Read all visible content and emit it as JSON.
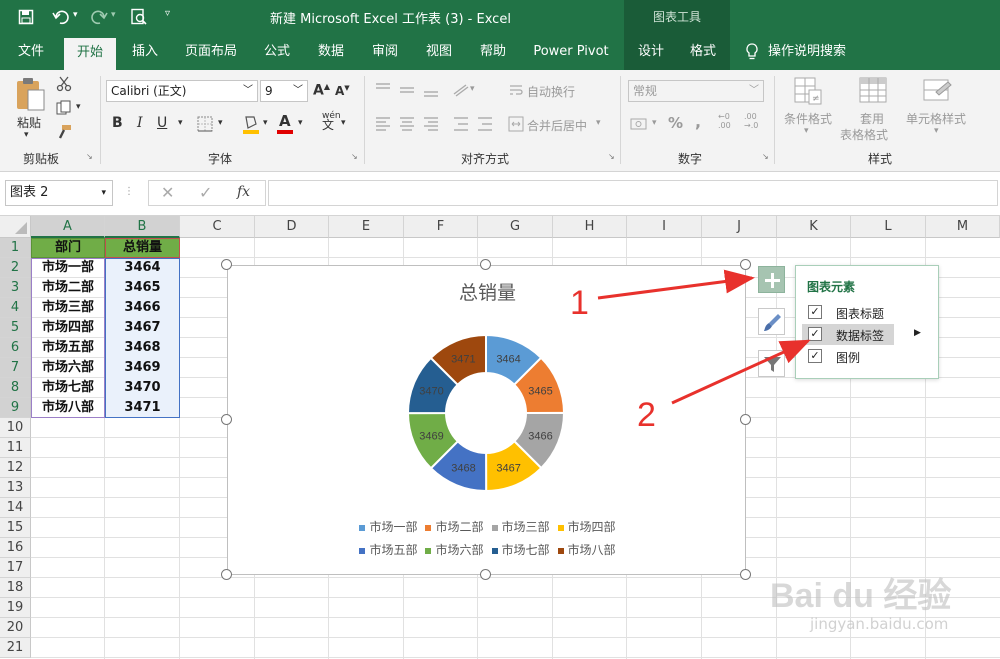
{
  "titlebar": {
    "title": "新建 Microsoft Excel 工作表 (3)  -  Excel",
    "contextual": "图表工具"
  },
  "tabs": [
    "文件",
    "开始",
    "插入",
    "页面布局",
    "公式",
    "数据",
    "审阅",
    "视图",
    "帮助",
    "Power Pivot",
    "设计",
    "格式"
  ],
  "tell_me": "操作说明搜索",
  "ribbon": {
    "paste_label": "粘贴",
    "font_name": "Calibri (正文)",
    "font_size": "9",
    "wrap_text": "自动换行",
    "merge_center": "合并后居中",
    "number_format": "常规",
    "conditional_format": "条件格式",
    "format_table_1": "套用",
    "format_table_2": "表格格式",
    "cell_styles": "单元格样式",
    "groups": {
      "clipboard": "剪贴板",
      "font": "字体",
      "alignment": "对齐方式",
      "number": "数字",
      "styles": "样式"
    }
  },
  "formula_bar": {
    "name_box": "图表 2",
    "fx": "fx",
    "formula": ""
  },
  "columns": [
    "A",
    "B",
    "C",
    "D",
    "E",
    "F",
    "G",
    "H",
    "I",
    "J",
    "K",
    "L",
    "M"
  ],
  "rows": [
    "1",
    "2",
    "3",
    "4",
    "5",
    "6",
    "7",
    "8",
    "9",
    "10",
    "11",
    "12",
    "13",
    "14",
    "15",
    "16",
    "17",
    "18",
    "19",
    "20",
    "21"
  ],
  "table": {
    "headers": [
      "部门",
      "总销量"
    ],
    "rows": [
      [
        "市场一部",
        "3464"
      ],
      [
        "市场二部",
        "3465"
      ],
      [
        "市场三部",
        "3466"
      ],
      [
        "市场四部",
        "3467"
      ],
      [
        "市场五部",
        "3468"
      ],
      [
        "市场六部",
        "3469"
      ],
      [
        "市场七部",
        "3470"
      ],
      [
        "市场八部",
        "3471"
      ]
    ],
    "header_color": "#70ad47"
  },
  "chart_data": {
    "type": "pie",
    "variant": "doughnut",
    "title": "总销量",
    "categories": [
      "市场一部",
      "市场二部",
      "市场三部",
      "市场四部",
      "市场五部",
      "市场六部",
      "市场七部",
      "市场八部"
    ],
    "values": [
      3464,
      3465,
      3466,
      3467,
      3468,
      3469,
      3470,
      3471
    ],
    "colors": [
      "#5b9bd5",
      "#ed7d31",
      "#a5a5a5",
      "#ffc000",
      "#4472c4",
      "#70ad47",
      "#255e91",
      "#9e480e"
    ],
    "data_labels": true,
    "legend": "bottom"
  },
  "chart_elements_panel": {
    "title": "图表元素",
    "items": [
      {
        "label": "图表标题",
        "checked": true
      },
      {
        "label": "数据标签",
        "checked": true
      },
      {
        "label": "图例",
        "checked": true
      }
    ]
  },
  "annotations": {
    "one": "1",
    "two": "2",
    "arrow_color": "#e8312c"
  },
  "watermark": {
    "brand": "Bai du 经验",
    "url": "jingyan.baidu.com"
  }
}
